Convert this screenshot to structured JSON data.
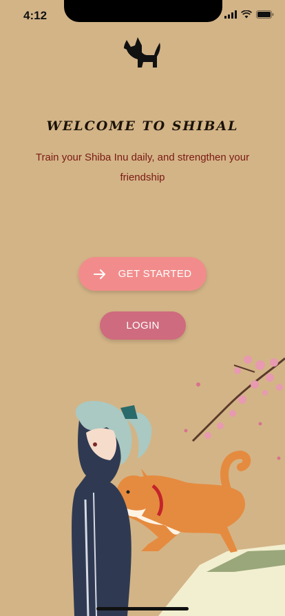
{
  "status_bar": {
    "time": "4:12",
    "icons": [
      "signal-icon",
      "wifi-icon",
      "battery-icon"
    ]
  },
  "app": {
    "logo_icon": "shiba-dog-icon"
  },
  "welcome": {
    "title": "WELCOME TO SHIBAL",
    "subtitle": "Train your Shiba Inu daily, and strengthen your friendship"
  },
  "actions": {
    "get_started_label": "GET STARTED",
    "get_started_icon": "arrow-right-icon",
    "login_label": "LOGIN"
  },
  "colors": {
    "background": "#d3b487",
    "title": "#1a1208",
    "subtitle": "#7a1a12",
    "primary_button": "#f28c8c",
    "secondary_button": "#cf6b7e"
  }
}
